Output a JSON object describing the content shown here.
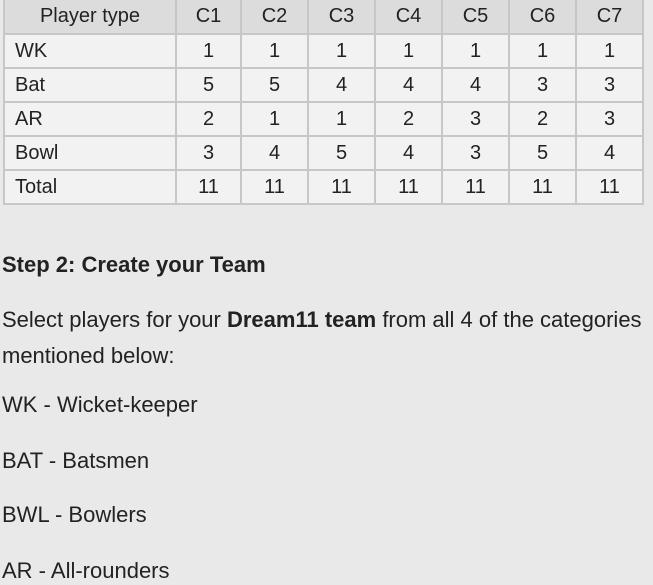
{
  "table": {
    "headers": [
      "Player type",
      "C1",
      "C2",
      "C3",
      "C4",
      "C5",
      "C6",
      "C7"
    ],
    "rows": [
      {
        "label": "WK",
        "values": [
          "1",
          "1",
          "1",
          "1",
          "1",
          "1",
          "1"
        ]
      },
      {
        "label": "Bat",
        "values": [
          "5",
          "5",
          "4",
          "4",
          "4",
          "3",
          "3"
        ]
      },
      {
        "label": "AR",
        "values": [
          "2",
          "1",
          "1",
          "2",
          "3",
          "2",
          "3"
        ]
      },
      {
        "label": "Bowl",
        "values": [
          "3",
          "4",
          "5",
          "4",
          "3",
          "5",
          "4"
        ]
      },
      {
        "label": "Total",
        "values": [
          "11",
          "11",
          "11",
          "11",
          "11",
          "11",
          "11"
        ]
      }
    ]
  },
  "step": {
    "heading": "Step 2: Create your Team",
    "intro_before": "Select players for your ",
    "intro_bold": "Dream11 team",
    "intro_after": " from all 4 of the categories mentioned below:",
    "categories": [
      "WK - Wicket-keeper",
      "BAT - Batsmen",
      "BWL - Bowlers",
      "AR - All-rounders"
    ]
  }
}
